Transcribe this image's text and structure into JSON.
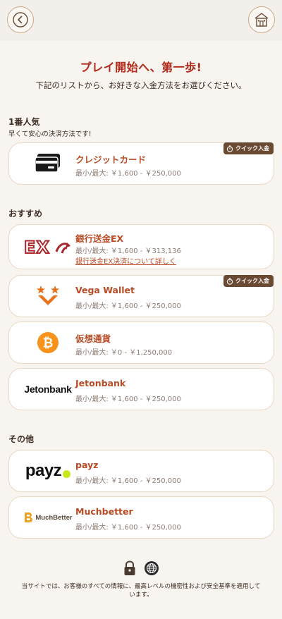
{
  "header": {
    "headline": "プレイ開始へ、第一歩!",
    "subhead": "下記のリストから、お好きな入金方法をお選びください。"
  },
  "sections": {
    "popular": {
      "title": "1番人気",
      "subtitle": "早くて安心の決済方法です!"
    },
    "recommended": {
      "title": "おすすめ"
    },
    "other": {
      "title": "その他"
    }
  },
  "quick_badge": "クイック入金",
  "methods": {
    "credit_card": {
      "name": "クレジットカード",
      "limit": "最小/最大: ￥1,600 - ￥250,000"
    },
    "bank_ex": {
      "name": "銀行送金EX",
      "limit": "最小/最大: ￥1,600 - ￥313,136",
      "link": "銀行送金EX決済について詳しく",
      "logo_text": "EX"
    },
    "vega": {
      "name": "Vega Wallet",
      "limit": "最小/最大: ￥1,600 - ￥250,000"
    },
    "crypto": {
      "name": "仮想通貨",
      "limit": "最小/最大: ￥0 - ￥1,250,000"
    },
    "jetonbank": {
      "name": "Jetonbank",
      "limit": "最小/最大: ￥1,600 - ￥250,000",
      "logo_text": "Jetonbank"
    },
    "payz": {
      "name": "payz",
      "limit": "最小/最大: ￥1,600 - ￥250,000",
      "logo_text": "payz"
    },
    "muchbetter": {
      "name": "Muchbetter",
      "limit": "最小/最大: ￥1,600 - ￥250,000",
      "logo_text": "MuchBetter"
    }
  },
  "footer": {
    "text": "当サイトでは、お客様のすべての情報に、最高レベルの機密性および安全基準を適用しています。"
  },
  "colors": {
    "accent": "#b02a1a",
    "method_name": "#b84a24",
    "badge_bg": "#6b4a34",
    "card_border": "#ead8c4",
    "background": "#f8f5f1"
  }
}
